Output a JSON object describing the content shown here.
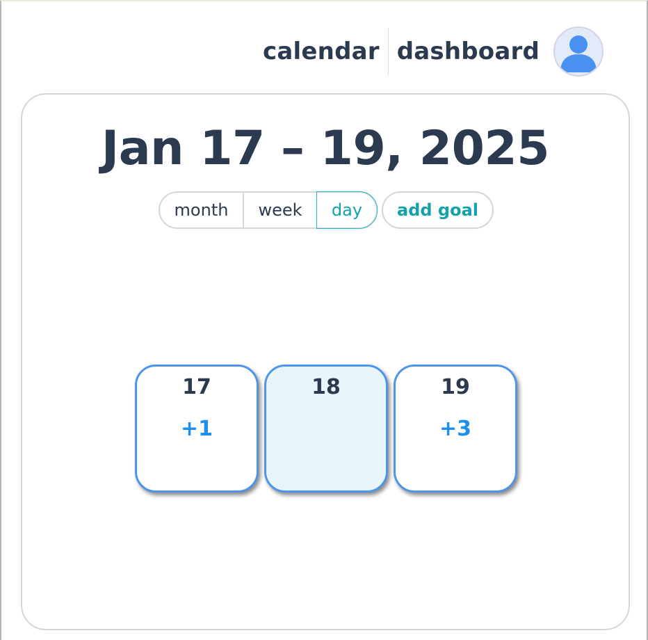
{
  "nav": {
    "calendar_label": "calendar",
    "dashboard_label": "dashboard"
  },
  "calendar": {
    "title": "Jan 17 – 19, 2025",
    "views": {
      "month": "month",
      "week": "week",
      "day": "day",
      "selected": "day"
    },
    "add_goal_label": "add goal",
    "days": [
      {
        "day": "17",
        "count": "+1",
        "highlighted": false
      },
      {
        "day": "18",
        "count": "",
        "highlighted": true
      },
      {
        "day": "19",
        "count": "+3",
        "highlighted": false
      }
    ]
  },
  "colors": {
    "text": "#2b3a4e",
    "accent_teal": "#14a1a8",
    "tile_border": "#4d94ea",
    "count_blue": "#1d8ff0",
    "today_bg": "#e8f6fc",
    "avatar_bg": "#e3ebfb",
    "avatar_icon": "#4a90f0"
  },
  "icons": {
    "avatar": "user-avatar-icon"
  }
}
